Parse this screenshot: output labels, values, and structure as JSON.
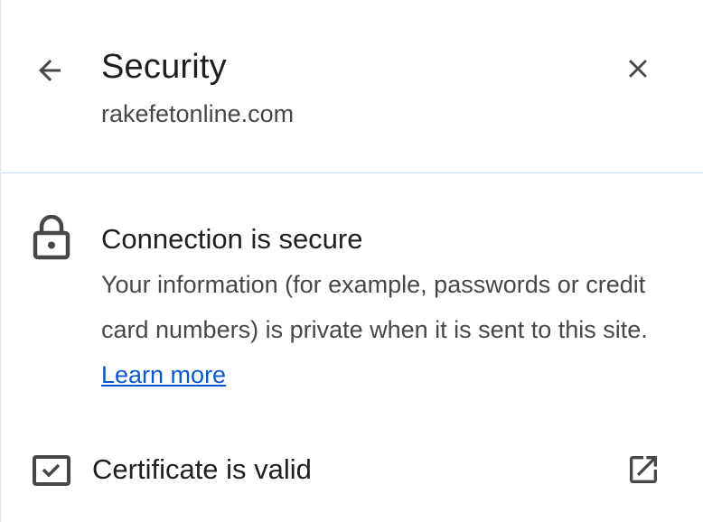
{
  "header": {
    "title": "Security",
    "site": "rakefetonline.com",
    "back_icon": "arrow-left-icon",
    "close_icon": "close-icon"
  },
  "connection": {
    "icon": "lock-icon",
    "title": "Connection is secure",
    "description": "Your information (for example, passwords or credit card numbers) is private when it is sent to this site.",
    "learn_more": "Learn more"
  },
  "certificate": {
    "icon": "certificate-check-icon",
    "title": "Certificate is valid",
    "open_icon": "open-in-new-icon"
  },
  "colors": {
    "text_primary": "#1f1f1f",
    "text_secondary": "#474747",
    "link": "#0b57d0",
    "divider": "#c7d7f5"
  }
}
